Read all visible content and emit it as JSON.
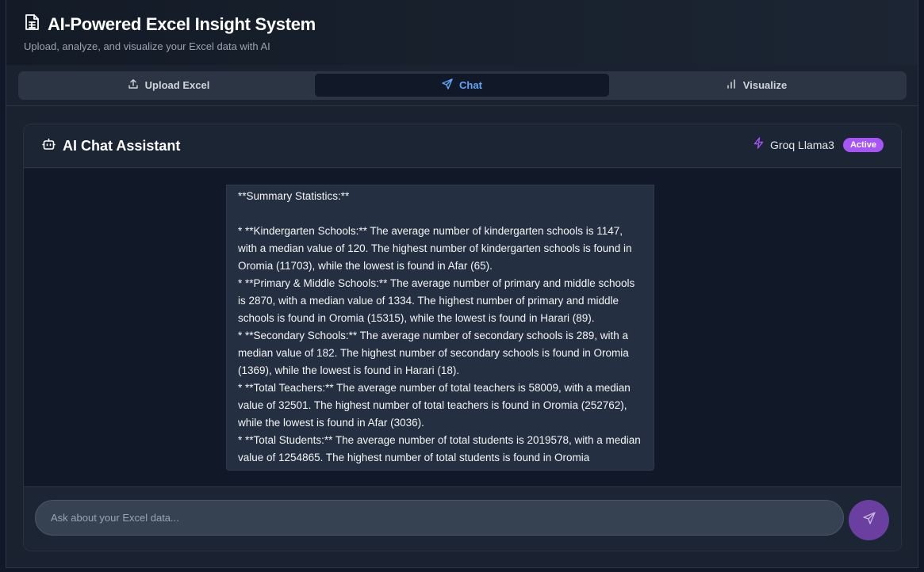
{
  "app": {
    "title": "AI-Powered Excel Insight System",
    "subtitle": "Upload, analyze, and visualize your Excel data with AI"
  },
  "tabs": [
    {
      "label": "Upload Excel",
      "icon": "upload-icon",
      "active": false
    },
    {
      "label": "Chat",
      "icon": "send-icon",
      "active": true
    },
    {
      "label": "Visualize",
      "icon": "bar-chart-icon",
      "active": false
    }
  ],
  "chat": {
    "title": "AI Chat Assistant",
    "model": "Groq Llama3",
    "status": "Active",
    "message_lines": [
      "**Summary Statistics:**",
      "",
      "* **Kindergarten Schools:** The average number of kindergarten schools is 1147, with a median value of 120. The highest number of kindergarten schools is found in Oromia (11703), while the lowest is found in Afar (65).",
      "* **Primary & Middle Schools:** The average number of primary and middle schools is 2870, with a median value of 1334. The highest number of primary and middle schools is found in Oromia (15315), while the lowest is found in Harari (89).",
      "* **Secondary Schools:** The average number of secondary schools is 289, with a median value of 182. The highest number of secondary schools is found in Oromia (1369), while the lowest is found in Harari (18).",
      "* **Total Teachers:** The average number of total teachers is 58009, with a median value of 32501. The highest number of total teachers is found in Oromia (252762), while the lowest is found in Afar (3036).",
      "* **Total Students:** The average number of total students is 2019578, with a median value of 1254865. The highest number of total students is found in Oromia"
    ],
    "input_placeholder": "Ask about your Excel data..."
  },
  "colors": {
    "accent_blue": "#60a5fa",
    "badge_purple": "#a855f7",
    "send_button": "#6b3fa0"
  }
}
